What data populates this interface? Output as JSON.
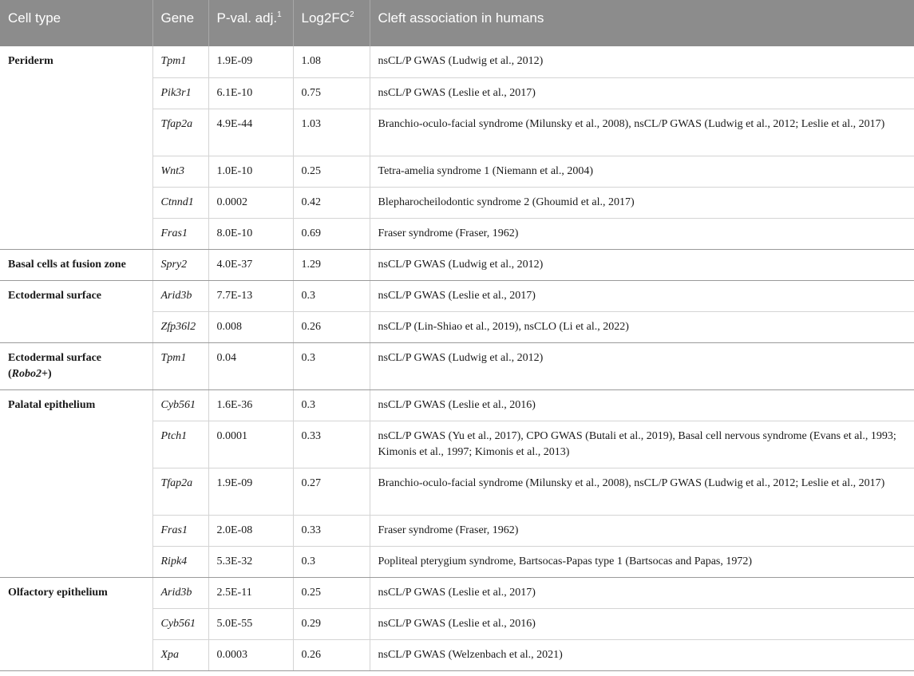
{
  "table": {
    "headers": {
      "cell_type": "Cell type",
      "gene": "Gene",
      "pval": "P-val. adj.",
      "pval_sup": "1",
      "log2fc": "Log2FC",
      "log2fc_sup": "2",
      "cleft": "Cleft association in humans"
    },
    "groups": [
      {
        "cell_type": "Periderm",
        "rows": [
          {
            "gene": "Tpm1",
            "pval": "1.9E-09",
            "log2fc": "1.08",
            "cleft": "nsCL/P GWAS (Ludwig et al., 2012)"
          },
          {
            "gene": "Pik3r1",
            "pval": "6.1E-10",
            "log2fc": "0.75",
            "cleft": "nsCL/P GWAS (Leslie et al., 2017)"
          },
          {
            "gene": "Tfap2a",
            "pval": "4.9E-44",
            "log2fc": "1.03",
            "cleft": "Branchio-oculo-facial syndrome (Milunsky et al., 2008), nsCL/P GWAS (Ludwig et al., 2012; Leslie et al., 2017)"
          },
          {
            "gene": "Wnt3",
            "pval": "1.0E-10",
            "log2fc": "0.25",
            "cleft": "Tetra-amelia syndrome 1 (Niemann et al., 2004)"
          },
          {
            "gene": "Ctnnd1",
            "pval": "0.0002",
            "log2fc": "0.42",
            "cleft": "Blepharocheilodontic syndrome 2 (Ghoumid et al., 2017)"
          },
          {
            "gene": "Fras1",
            "pval": "8.0E-10",
            "log2fc": "0.69",
            "cleft": "Fraser syndrome (Fraser, 1962)"
          }
        ]
      },
      {
        "cell_type": "Basal cells at fusion zone",
        "rows": [
          {
            "gene": "Spry2",
            "pval": "4.0E-37",
            "log2fc": "1.29",
            "cleft": "nsCL/P GWAS (Ludwig et al., 2012)"
          }
        ]
      },
      {
        "cell_type": "Ectodermal surface",
        "rows": [
          {
            "gene": "Arid3b",
            "pval": "7.7E-13",
            "log2fc": "0.3",
            "cleft": "nsCL/P GWAS (Leslie et al., 2017)"
          },
          {
            "gene": "Zfp36l2",
            "pval": "0.008",
            "log2fc": "0.26",
            "cleft": "nsCL/P (Lin-Shiao et al., 2019), nsCLO (Li et al., 2022)"
          }
        ]
      },
      {
        "cell_type": "Ectodermal surface",
        "cell_type_line2_pre": "(",
        "cell_type_line2_em": "Robo2",
        "cell_type_line2_post": "+)",
        "rows": [
          {
            "gene": "Tpm1",
            "pval": "0.04",
            "log2fc": "0.3",
            "cleft": "nsCL/P GWAS (Ludwig et al., 2012)"
          }
        ]
      },
      {
        "cell_type": "Palatal epithelium",
        "rows": [
          {
            "gene": "Cyb561",
            "pval": "1.6E-36",
            "log2fc": "0.3",
            "cleft": "nsCL/P GWAS (Leslie et al., 2016)"
          },
          {
            "gene": "Ptch1",
            "pval": "0.0001",
            "log2fc": "0.33",
            "cleft": "nsCL/P GWAS (Yu et al., 2017), CPO GWAS (Butali et al., 2019), Basal cell nervous syndrome (Evans et al., 1993; Kimonis et al., 1997; Kimonis et al., 2013)"
          },
          {
            "gene": "Tfap2a",
            "pval": "1.9E-09",
            "log2fc": "0.27",
            "cleft": "Branchio-oculo-facial syndrome (Milunsky et al., 2008), nsCL/P GWAS (Ludwig et al., 2012; Leslie et al., 2017)"
          },
          {
            "gene": "Fras1",
            "pval": "2.0E-08",
            "log2fc": "0.33",
            "cleft": "Fraser syndrome (Fraser, 1962)"
          },
          {
            "gene": "Ripk4",
            "pval": "5.3E-32",
            "log2fc": "0.3",
            "cleft": "Popliteal pterygium syndrome, Bartsocas-Papas type 1 (Bartsocas and Papas, 1972)"
          }
        ]
      },
      {
        "cell_type": "Olfactory epithelium",
        "rows": [
          {
            "gene": "Arid3b",
            "pval": "2.5E-11",
            "log2fc": "0.25",
            "cleft": "nsCL/P GWAS (Leslie et al., 2017)"
          },
          {
            "gene": "Cyb561",
            "pval": "5.0E-55",
            "log2fc": "0.29",
            "cleft": "nsCL/P GWAS (Leslie et al., 2016)"
          },
          {
            "gene": "Xpa",
            "pval": "0.0003",
            "log2fc": "0.26",
            "cleft": "nsCL/P GWAS (Welzenbach et al., 2021)"
          }
        ]
      }
    ]
  }
}
